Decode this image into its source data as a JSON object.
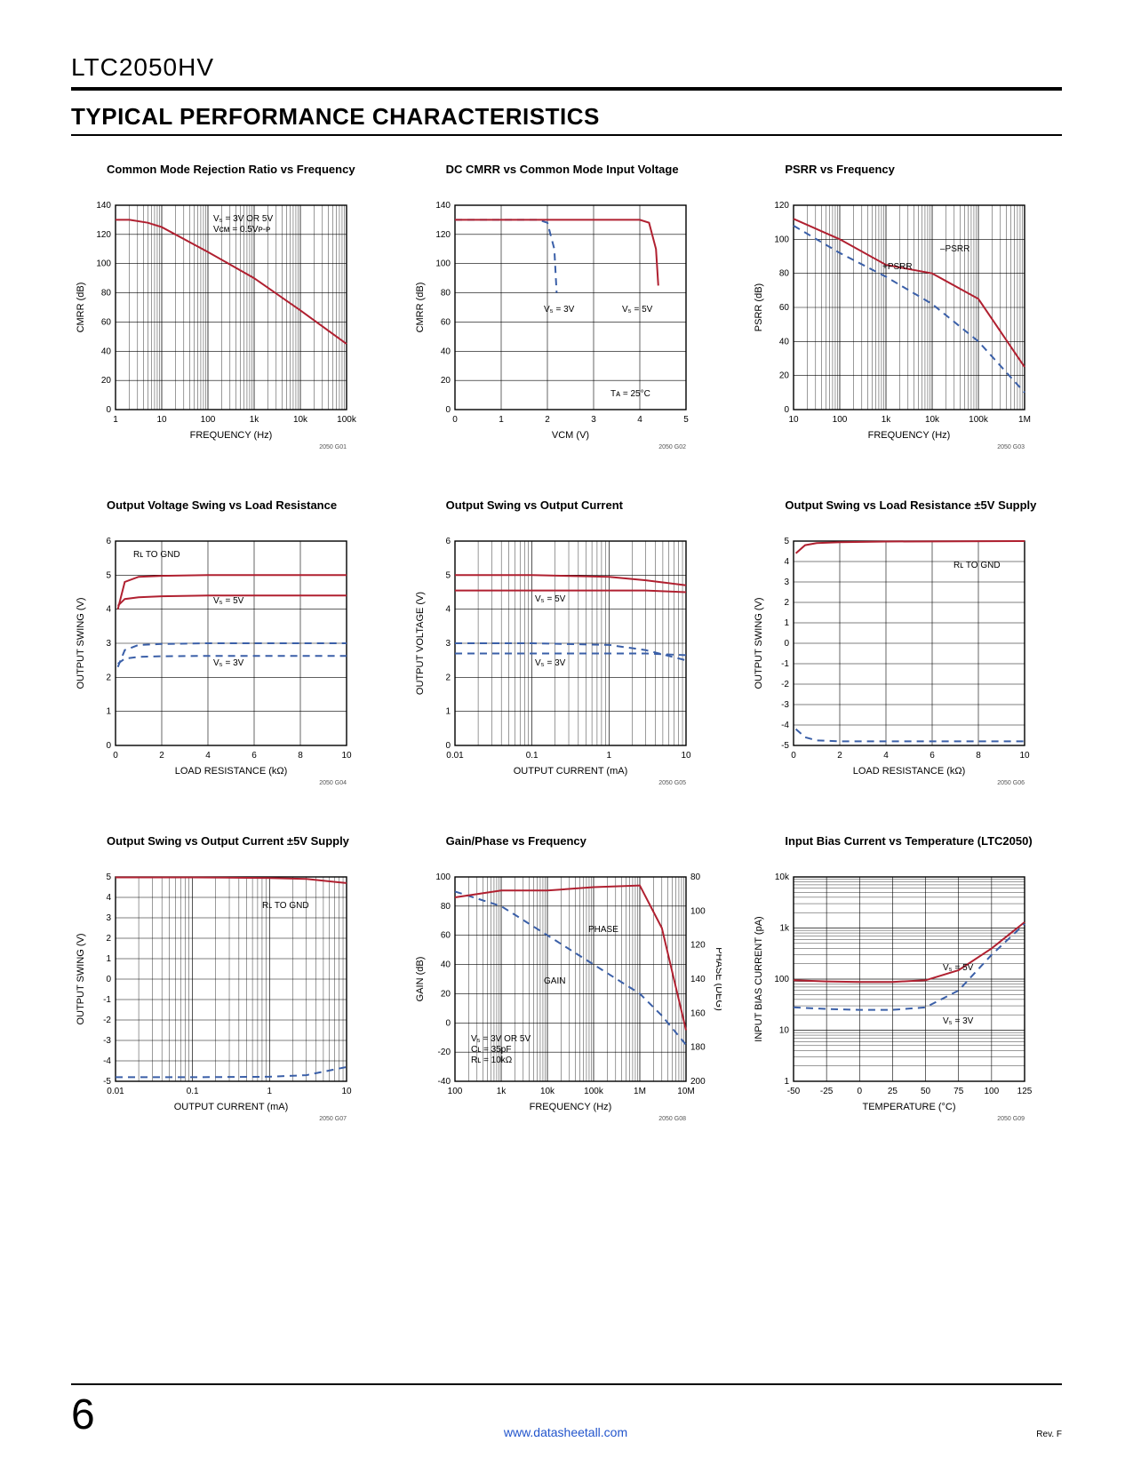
{
  "part": "LTC2050HV",
  "section": "TYPICAL PERFORMANCE CHARACTERISTICS",
  "page_number": "6",
  "url": "www.datasheetall.com",
  "rev": "Rev. F",
  "charts": [
    {
      "title": "Common Mode Rejection Ratio vs Frequency",
      "xlabel": "FREQUENCY (Hz)",
      "ylabel": "CMRR (dB)",
      "fig_id": "2050 G01",
      "annotations": [
        "V₅ = 3V OR 5V",
        "Vᴄᴍ = 0.5Vᴘ-ᴘ"
      ]
    },
    {
      "title": "DC CMRR vs Common Mode Input Voltage",
      "xlabel": "Vᴄᴍ (V)",
      "ylabel": "CMRR (dB)",
      "fig_id": "2050 G02",
      "annotations": [
        "V₅ = 3V",
        "V₅ = 5V",
        "Tᴀ = 25°C"
      ]
    },
    {
      "title": "PSRR vs Frequency",
      "xlabel": "FREQUENCY (Hz)",
      "ylabel": "PSRR (dB)",
      "fig_id": "2050 G03",
      "annotations": [
        "–PSRR",
        "+PSRR"
      ]
    },
    {
      "title": "Output Voltage Swing vs Load Resistance",
      "xlabel": "LOAD RESISTANCE (kΩ)",
      "ylabel": "OUTPUT SWING (V)",
      "fig_id": "2050 G04",
      "annotations": [
        "Rʟ TO GND",
        "V₅ = 5V",
        "V₅ = 3V"
      ]
    },
    {
      "title": "Output Swing vs Output Current",
      "xlabel": "OUTPUT CURRENT (mA)",
      "ylabel": "OUTPUT VOLTAGE (V)",
      "fig_id": "2050 G05",
      "annotations": [
        "V₅ = 5V",
        "V₅ = 3V"
      ]
    },
    {
      "title": "Output Swing vs Load Resistance ±5V Supply",
      "xlabel": "LOAD RESISTANCE (kΩ)",
      "ylabel": "OUTPUT SWING (V)",
      "fig_id": "2050 G06",
      "annotations": [
        "Rʟ TO GND"
      ]
    },
    {
      "title": "Output Swing vs Output Current ±5V Supply",
      "xlabel": "OUTPUT CURRENT (mA)",
      "ylabel": "OUTPUT SWING (V)",
      "fig_id": "2050 G07",
      "annotations": [
        "Rʟ TO GND"
      ]
    },
    {
      "title": "Gain/Phase vs Frequency",
      "xlabel": "FREQUENCY (Hz)",
      "ylabel": "GAIN (dB)",
      "ylabel2": "PHASE (DEG)",
      "fig_id": "2050 G08",
      "annotations": [
        "PHASE",
        "GAIN",
        "V₅ = 3V OR 5V",
        "Cʟ = 35pF",
        "Rʟ = 10kΩ"
      ]
    },
    {
      "title": "Input Bias Current vs Temperature (LTC2050)",
      "xlabel": "TEMPERATURE (°C)",
      "ylabel": "INPUT BIAS CURRENT (pA)",
      "fig_id": "2050 G09",
      "annotations": [
        "V₅ = 5V",
        "V₅ = 3V"
      ]
    }
  ],
  "chart_data": [
    {
      "type": "line",
      "xscale": "log",
      "xlabel": "FREQUENCY (Hz)",
      "ylabel": "CMRR (dB)",
      "xlim": [
        1,
        100000
      ],
      "ylim": [
        0,
        140
      ],
      "xticks": [
        1,
        10,
        100,
        1000,
        10000,
        100000
      ],
      "xtick_labels": [
        "1",
        "10",
        "100",
        "1k",
        "10k",
        "100k"
      ],
      "yticks": [
        0,
        20,
        40,
        60,
        80,
        100,
        120,
        140
      ],
      "series": [
        {
          "name": "CMRR",
          "color": "#B02030",
          "dash": "none",
          "x": [
            1,
            2,
            5,
            10,
            100,
            1000,
            10000,
            100000
          ],
          "y": [
            130,
            130,
            128,
            125,
            108,
            90,
            68,
            45
          ]
        }
      ]
    },
    {
      "type": "line",
      "xscale": "linear",
      "xlabel": "VCM (V)",
      "ylabel": "CMRR (dB)",
      "xlim": [
        0,
        5
      ],
      "ylim": [
        0,
        140
      ],
      "xticks": [
        0,
        1,
        2,
        3,
        4,
        5
      ],
      "yticks": [
        0,
        20,
        40,
        60,
        80,
        100,
        120,
        140
      ],
      "series": [
        {
          "name": "VS=3V",
          "color": "#3A5FA8",
          "dash": "8,6",
          "x": [
            0,
            1.8,
            2.0,
            2.15,
            2.2
          ],
          "y": [
            130,
            130,
            128,
            110,
            80
          ]
        },
        {
          "name": "VS=5V",
          "color": "#B02030",
          "dash": "none",
          "x": [
            0,
            4.0,
            4.2,
            4.35,
            4.4
          ],
          "y": [
            130,
            130,
            128,
            110,
            85
          ]
        }
      ]
    },
    {
      "type": "line",
      "xscale": "log",
      "xlabel": "FREQUENCY (Hz)",
      "ylabel": "PSRR (dB)",
      "xlim": [
        10,
        1000000
      ],
      "ylim": [
        0,
        120
      ],
      "xticks": [
        10,
        100,
        1000,
        10000,
        100000,
        1000000
      ],
      "xtick_labels": [
        "10",
        "100",
        "1k",
        "10k",
        "100k",
        "1M"
      ],
      "yticks": [
        0,
        20,
        40,
        60,
        80,
        100,
        120
      ],
      "series": [
        {
          "name": "-PSRR",
          "color": "#B02030",
          "dash": "none",
          "x": [
            10,
            100,
            1000,
            10000,
            100000,
            1000000
          ],
          "y": [
            112,
            100,
            85,
            80,
            65,
            25
          ]
        },
        {
          "name": "+PSRR",
          "color": "#3A5FA8",
          "dash": "8,6",
          "x": [
            10,
            100,
            1000,
            10000,
            100000,
            1000000
          ],
          "y": [
            108,
            92,
            78,
            62,
            40,
            10
          ]
        }
      ]
    },
    {
      "type": "line",
      "xscale": "linear",
      "xlabel": "LOAD RESISTANCE (kΩ)",
      "ylabel": "OUTPUT SWING (V)",
      "xlim": [
        0,
        10
      ],
      "ylim": [
        0,
        6
      ],
      "xticks": [
        0,
        2,
        4,
        6,
        8,
        10
      ],
      "yticks": [
        0,
        1,
        2,
        3,
        4,
        5,
        6
      ],
      "series": [
        {
          "name": "VS=5V top",
          "color": "#B02030",
          "dash": "none",
          "x": [
            0.1,
            0.4,
            1,
            2,
            4,
            10
          ],
          "y": [
            4.0,
            4.8,
            4.95,
            4.98,
            5.0,
            5.0
          ]
        },
        {
          "name": "VS=5V bot",
          "color": "#B02030",
          "dash": "none",
          "x": [
            0.1,
            0.4,
            1,
            2,
            4,
            10
          ],
          "y": [
            4.1,
            4.3,
            4.35,
            4.38,
            4.4,
            4.4
          ]
        },
        {
          "name": "VS=3V top",
          "color": "#3A5FA8",
          "dash": "8,6",
          "x": [
            0.1,
            0.4,
            1,
            2,
            4,
            10
          ],
          "y": [
            2.3,
            2.8,
            2.95,
            2.98,
            3.0,
            3.0
          ]
        },
        {
          "name": "VS=3V bot",
          "color": "#3A5FA8",
          "dash": "8,6",
          "x": [
            0.1,
            0.4,
            1,
            2,
            4,
            10
          ],
          "y": [
            2.4,
            2.55,
            2.6,
            2.62,
            2.63,
            2.63
          ]
        }
      ]
    },
    {
      "type": "line",
      "xscale": "log",
      "xlabel": "OUTPUT CURRENT (mA)",
      "ylabel": "OUTPUT VOLTAGE (V)",
      "xlim": [
        0.01,
        10
      ],
      "ylim": [
        0,
        6
      ],
      "xticks": [
        0.01,
        0.1,
        1,
        10
      ],
      "xtick_labels": [
        "0.01",
        "0.1",
        "1",
        "10"
      ],
      "yticks": [
        0,
        1,
        2,
        3,
        4,
        5,
        6
      ],
      "series": [
        {
          "name": "VS=5V top",
          "color": "#B02030",
          "dash": "none",
          "x": [
            0.01,
            0.1,
            1,
            3,
            10
          ],
          "y": [
            5.0,
            5.0,
            4.95,
            4.85,
            4.7
          ]
        },
        {
          "name": "VS=5V bot",
          "color": "#B02030",
          "dash": "none",
          "x": [
            0.01,
            0.1,
            1,
            3,
            10
          ],
          "y": [
            4.55,
            4.55,
            4.55,
            4.55,
            4.5
          ]
        },
        {
          "name": "VS=3V top",
          "color": "#3A5FA8",
          "dash": "8,6",
          "x": [
            0.01,
            0.1,
            1,
            3,
            10
          ],
          "y": [
            3.0,
            3.0,
            2.95,
            2.8,
            2.5
          ]
        },
        {
          "name": "VS=3V bot",
          "color": "#3A5FA8",
          "dash": "8,6",
          "x": [
            0.01,
            0.1,
            1,
            3,
            10
          ],
          "y": [
            2.7,
            2.7,
            2.7,
            2.7,
            2.65
          ]
        }
      ]
    },
    {
      "type": "line",
      "xscale": "linear",
      "xlabel": "LOAD RESISTANCE (kΩ)",
      "ylabel": "OUTPUT SWING (V)",
      "xlim": [
        0,
        10
      ],
      "ylim": [
        -5,
        5
      ],
      "xticks": [
        0,
        2,
        4,
        6,
        8,
        10
      ],
      "yticks": [
        -5,
        -4,
        -3,
        -2,
        -1,
        0,
        1,
        2,
        3,
        4,
        5
      ],
      "series": [
        {
          "name": "+swing",
          "color": "#B02030",
          "dash": "none",
          "x": [
            0.1,
            0.5,
            1,
            2,
            4,
            10
          ],
          "y": [
            4.4,
            4.8,
            4.9,
            4.95,
            4.98,
            5.0
          ]
        },
        {
          "name": "-swing",
          "color": "#3A5FA8",
          "dash": "8,6",
          "x": [
            0.1,
            0.5,
            1,
            2,
            4,
            10
          ],
          "y": [
            -4.2,
            -4.6,
            -4.75,
            -4.8,
            -4.8,
            -4.8
          ]
        }
      ]
    },
    {
      "type": "line",
      "xscale": "log",
      "xlabel": "OUTPUT CURRENT (mA)",
      "ylabel": "OUTPUT SWING (V)",
      "xlim": [
        0.01,
        10
      ],
      "ylim": [
        -5,
        5
      ],
      "xticks": [
        0.01,
        0.1,
        1,
        10
      ],
      "xtick_labels": [
        "0.01",
        "0.1",
        "1",
        "10"
      ],
      "yticks": [
        -5,
        -4,
        -3,
        -2,
        -1,
        0,
        1,
        2,
        3,
        4,
        5
      ],
      "series": [
        {
          "name": "+swing",
          "color": "#B02030",
          "dash": "none",
          "x": [
            0.01,
            0.1,
            1,
            3,
            10
          ],
          "y": [
            4.98,
            4.98,
            4.95,
            4.9,
            4.7
          ]
        },
        {
          "name": "-swing",
          "color": "#3A5FA8",
          "dash": "8,6",
          "x": [
            0.01,
            0.1,
            1,
            3,
            10
          ],
          "y": [
            -4.8,
            -4.8,
            -4.78,
            -4.7,
            -4.3
          ]
        }
      ]
    },
    {
      "type": "line",
      "xscale": "log",
      "xlabel": "FREQUENCY (Hz)",
      "ylabel": "GAIN (dB)",
      "xlim": [
        100,
        10000000
      ],
      "ylim": [
        -40,
        100
      ],
      "xticks": [
        100,
        1000,
        10000,
        100000,
        1000000,
        10000000
      ],
      "xtick_labels": [
        "100",
        "1k",
        "10k",
        "100k",
        "1M",
        "10M"
      ],
      "yticks": [
        -40,
        -20,
        0,
        20,
        40,
        60,
        80,
        100
      ],
      "y2lim": [
        200,
        80
      ],
      "y2ticks": [
        80,
        100,
        120,
        140,
        160,
        180,
        200
      ],
      "series": [
        {
          "name": "GAIN",
          "color": "#3A5FA8",
          "dash": "8,6",
          "axis": "y",
          "x": [
            100,
            1000,
            10000,
            100000,
            1000000,
            3000000,
            10000000
          ],
          "y": [
            90,
            80,
            60,
            40,
            20,
            5,
            -15
          ]
        },
        {
          "name": "PHASE",
          "color": "#B02030",
          "dash": "none",
          "axis": "y2",
          "x": [
            100,
            1000,
            10000,
            100000,
            1000000,
            3000000,
            10000000
          ],
          "y": [
            92,
            88,
            88,
            86,
            85,
            110,
            170
          ]
        }
      ]
    },
    {
      "type": "line",
      "xscale": "linear",
      "yscale": "log",
      "xlabel": "TEMPERATURE (°C)",
      "ylabel": "INPUT BIAS CURRENT (pA)",
      "xlim": [
        -50,
        125
      ],
      "ylim": [
        1,
        10000
      ],
      "xticks": [
        -50,
        -25,
        0,
        25,
        50,
        75,
        100,
        125
      ],
      "yticks": [
        1,
        10,
        100,
        1000,
        10000
      ],
      "ytick_labels": [
        "1",
        "10",
        "100",
        "1k",
        "10k"
      ],
      "series": [
        {
          "name": "VS=5V",
          "color": "#B02030",
          "dash": "none",
          "x": [
            -50,
            -25,
            0,
            25,
            50,
            75,
            100,
            125
          ],
          "y": [
            95,
            90,
            88,
            88,
            95,
            150,
            400,
            1300
          ]
        },
        {
          "name": "VS=3V",
          "color": "#3A5FA8",
          "dash": "8,6",
          "x": [
            -50,
            -25,
            0,
            25,
            50,
            75,
            100,
            125
          ],
          "y": [
            28,
            26,
            25,
            25,
            28,
            60,
            300,
            1200
          ]
        }
      ]
    }
  ]
}
